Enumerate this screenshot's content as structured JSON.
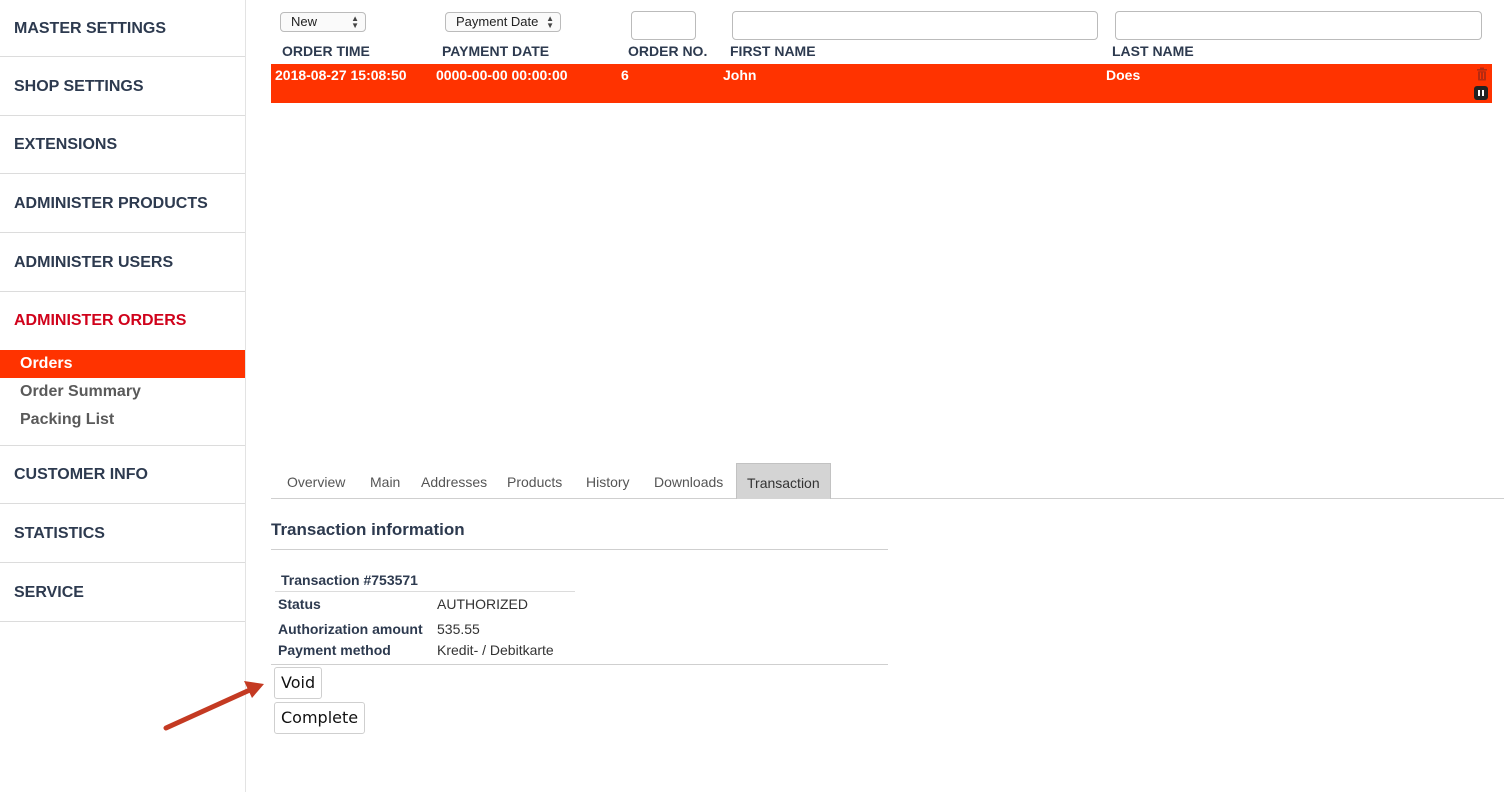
{
  "sidebar": {
    "sections": [
      {
        "label": "MASTER SETTINGS"
      },
      {
        "label": "SHOP SETTINGS"
      },
      {
        "label": "EXTENSIONS"
      },
      {
        "label": "ADMINISTER PRODUCTS"
      },
      {
        "label": "ADMINISTER USERS"
      },
      {
        "label": "ADMINISTER ORDERS",
        "items": [
          "Orders",
          "Order Summary",
          "Packing List"
        ]
      },
      {
        "label": "CUSTOMER INFO"
      },
      {
        "label": "STATISTICS"
      },
      {
        "label": "SERVICE"
      }
    ]
  },
  "filters": {
    "status_value": "New",
    "date_type_value": "Payment Date"
  },
  "columns": [
    "ORDER TIME",
    "PAYMENT DATE",
    "ORDER NO.",
    "FIRST NAME",
    "LAST NAME"
  ],
  "order_row": {
    "order_time": "2018-08-27 15:08:50",
    "payment_date": "0000-00-00 00:00:00",
    "order_no": "6",
    "first_name": "John",
    "last_name": "Does"
  },
  "tabs": [
    "Overview",
    "Main",
    "Addresses",
    "Products",
    "History",
    "Downloads",
    "Transaction"
  ],
  "transaction": {
    "section_title": "Transaction information",
    "title": "Transaction #753571",
    "status_label": "Status",
    "status_value": "AUTHORIZED",
    "amount_label": "Authorization amount",
    "amount_value": "535.55",
    "method_label": "Payment method",
    "method_value": "Kredit- / Debitkarte",
    "void_label": "Void",
    "complete_label": "Complete"
  },
  "colors": {
    "accent": "#ff3300",
    "active_section": "#d0021b"
  }
}
